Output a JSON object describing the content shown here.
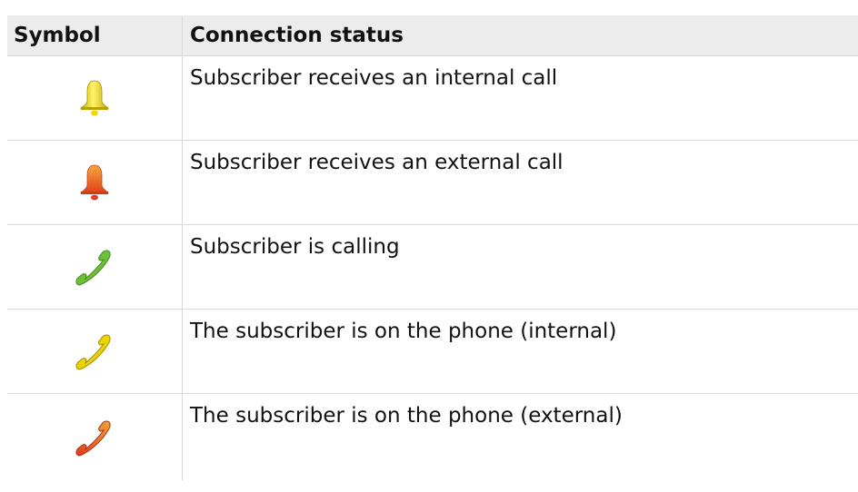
{
  "header": {
    "symbol_label": "Symbol",
    "status_label": "Connection status"
  },
  "rows": [
    {
      "icon": "bell-yellow-icon",
      "color": "#f0d400",
      "status": "Subscriber receives an internal call"
    },
    {
      "icon": "bell-orange-icon",
      "color": "#ee6a20",
      "status": "Subscriber receives an external call"
    },
    {
      "icon": "handset-green-icon",
      "color": "#6fbf3a",
      "status": "Subscriber is calling"
    },
    {
      "icon": "handset-yellow-icon",
      "color": "#e9d400",
      "status": "The subscriber is on the phone (internal)"
    },
    {
      "icon": "handset-orange-icon",
      "color": "#e0602a",
      "status": "The subscriber is on the phone (external)"
    }
  ]
}
